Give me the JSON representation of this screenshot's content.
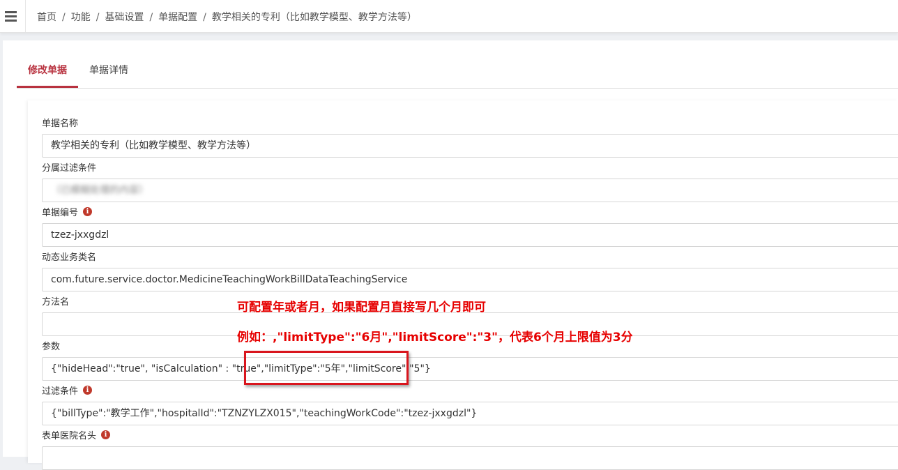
{
  "breadcrumb": {
    "items": [
      "首页",
      "功能",
      "基础设置",
      "单据配置"
    ],
    "current": "教学相关的专利（比如教学模型、教学方法等）"
  },
  "tabs": [
    {
      "label": "修改单据",
      "active": true
    },
    {
      "label": "单据详情",
      "active": false
    }
  ],
  "form": {
    "bill_name": {
      "label": "单据名称",
      "value": "教学相关的专利（比如教学模型、教学方法等）"
    },
    "filter_condition_sub": {
      "label": "分属过滤条件",
      "value": "（已模糊处理的内容）"
    },
    "bill_code": {
      "label": "单据编号",
      "value": "tzez-jxxgdzl"
    },
    "service_class": {
      "label": "动态业务类名",
      "value": "com.future.service.doctor.MedicineTeachingWorkBillDataTeachingService"
    },
    "method_name": {
      "label": "方法名",
      "value": ""
    },
    "params": {
      "label": "参数",
      "value": "{\"hideHead\":\"true\", \"isCalculation\" : \"true\",\"limitType\":\"5年\",\"limitScore\":\"5\"}"
    },
    "filter": {
      "label": "过滤条件",
      "value": "{\"billType\":\"教学工作\",\"hospitalId\":\"TZNZYLZX015\",\"teachingWorkCode\":\"tzez-jxxgdzl\"}"
    },
    "hospital_header": {
      "label": "表单医院名头",
      "value": ""
    }
  },
  "annotations": {
    "line1": "可配置年或者月，如果配置月直接写几个月即可",
    "line2": "例如：,\"limitType\":\"6月\",\"limitScore\":\"3\"，代表6个月上限值为3分"
  },
  "colors": {
    "accent": "#b8323f",
    "annotation": "#e60000",
    "info_icon": "#c0392b"
  },
  "icons": {
    "menu": "hamburger-menu-icon",
    "info": "info-icon"
  }
}
